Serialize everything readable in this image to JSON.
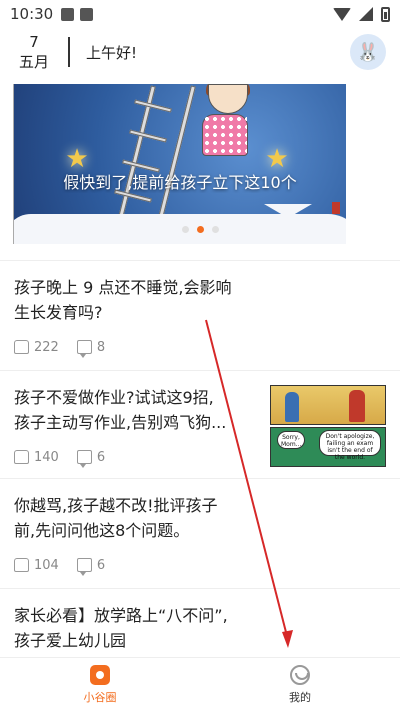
{
  "status_bar": {
    "time": "10:30"
  },
  "header": {
    "day": "7",
    "month": "五月",
    "greeting": "上午好!"
  },
  "banner": {
    "caption": "假快到了,提前给孩子立下这10个",
    "dots": 3,
    "active_dot": 1
  },
  "articles": [
    {
      "title_line1": "孩子晚上 9 点还不睡觉,会影响",
      "title_line2": "生长发育吗?",
      "likes": "222",
      "comments": "8",
      "has_thumb": false
    },
    {
      "title_line1": "孩子不爱做作业?试试这9招,",
      "title_line2": "孩子主动写作业,告别鸡飞狗...",
      "likes": "140",
      "comments": "6",
      "has_thumb": true,
      "thumb_text_1": "Sorry, Mom...",
      "thumb_text_2": "Don't apologize, failing an exam isn't the end of the world."
    },
    {
      "title_line1": "你越骂,孩子越不改!批评孩子",
      "title_line2": "前,先问问他这8个问题。",
      "likes": "104",
      "comments": "6",
      "has_thumb": false
    },
    {
      "title_line1": "家长必看】放学路上“八不问”,",
      "title_line2": "孩子爱上幼儿园",
      "has_thumb": false
    }
  ],
  "bottom_nav": {
    "items": [
      {
        "label": "小谷圈",
        "icon": "home-icon",
        "active": true
      },
      {
        "label": "我的",
        "icon": "profile-icon",
        "active": false
      }
    ]
  },
  "colors": {
    "accent": "#f36d1f",
    "annotation": "#d62828"
  }
}
